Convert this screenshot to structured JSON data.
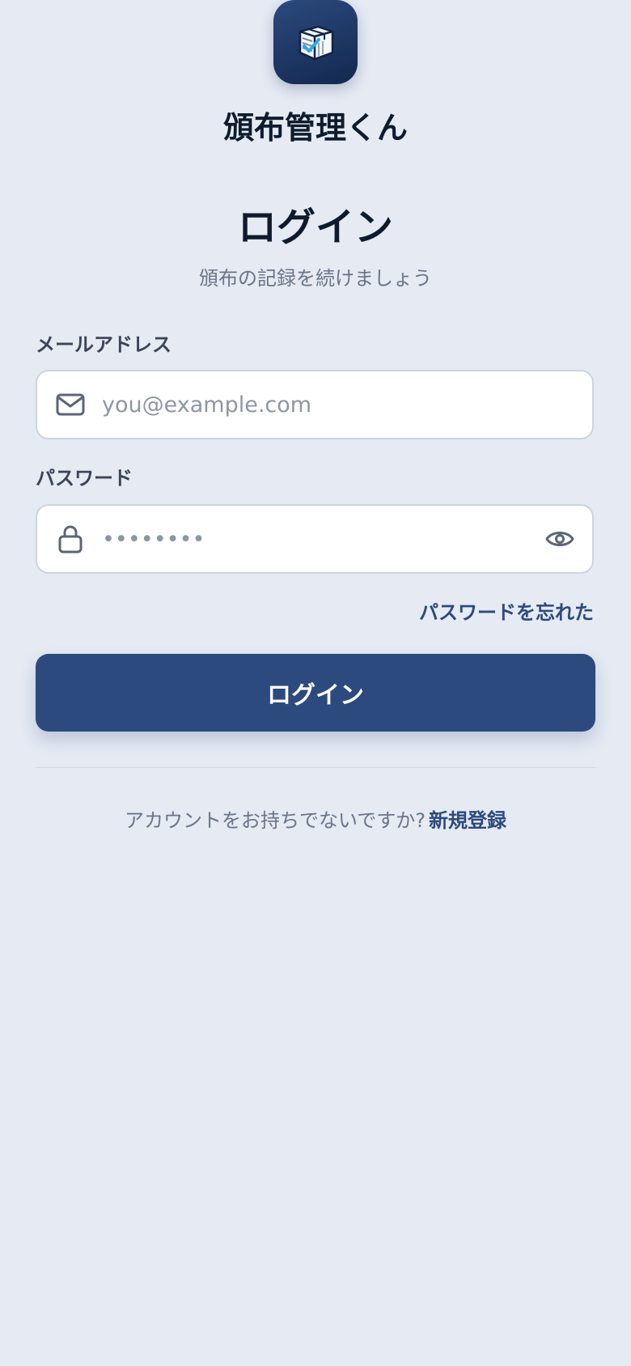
{
  "app": {
    "name": "頒布管理くん",
    "logo_icon": "box-checklist-icon",
    "brand_color": "#2c4a7e"
  },
  "login": {
    "title": "ログイン",
    "subtitle": "頒布の記録を続けましょう",
    "email": {
      "label": "メールアドレス",
      "placeholder": "you@example.com",
      "value": "",
      "icon": "mail-icon"
    },
    "password": {
      "label": "パスワード",
      "placeholder": "••••••••",
      "value": "",
      "icon": "lock-icon",
      "toggle_icon": "eye-icon"
    },
    "forgot_password": "パスワードを忘れた",
    "submit_label": "ログイン"
  },
  "signup": {
    "prompt": "アカウントをお持ちでないですか?",
    "link_label": "新規登録"
  }
}
